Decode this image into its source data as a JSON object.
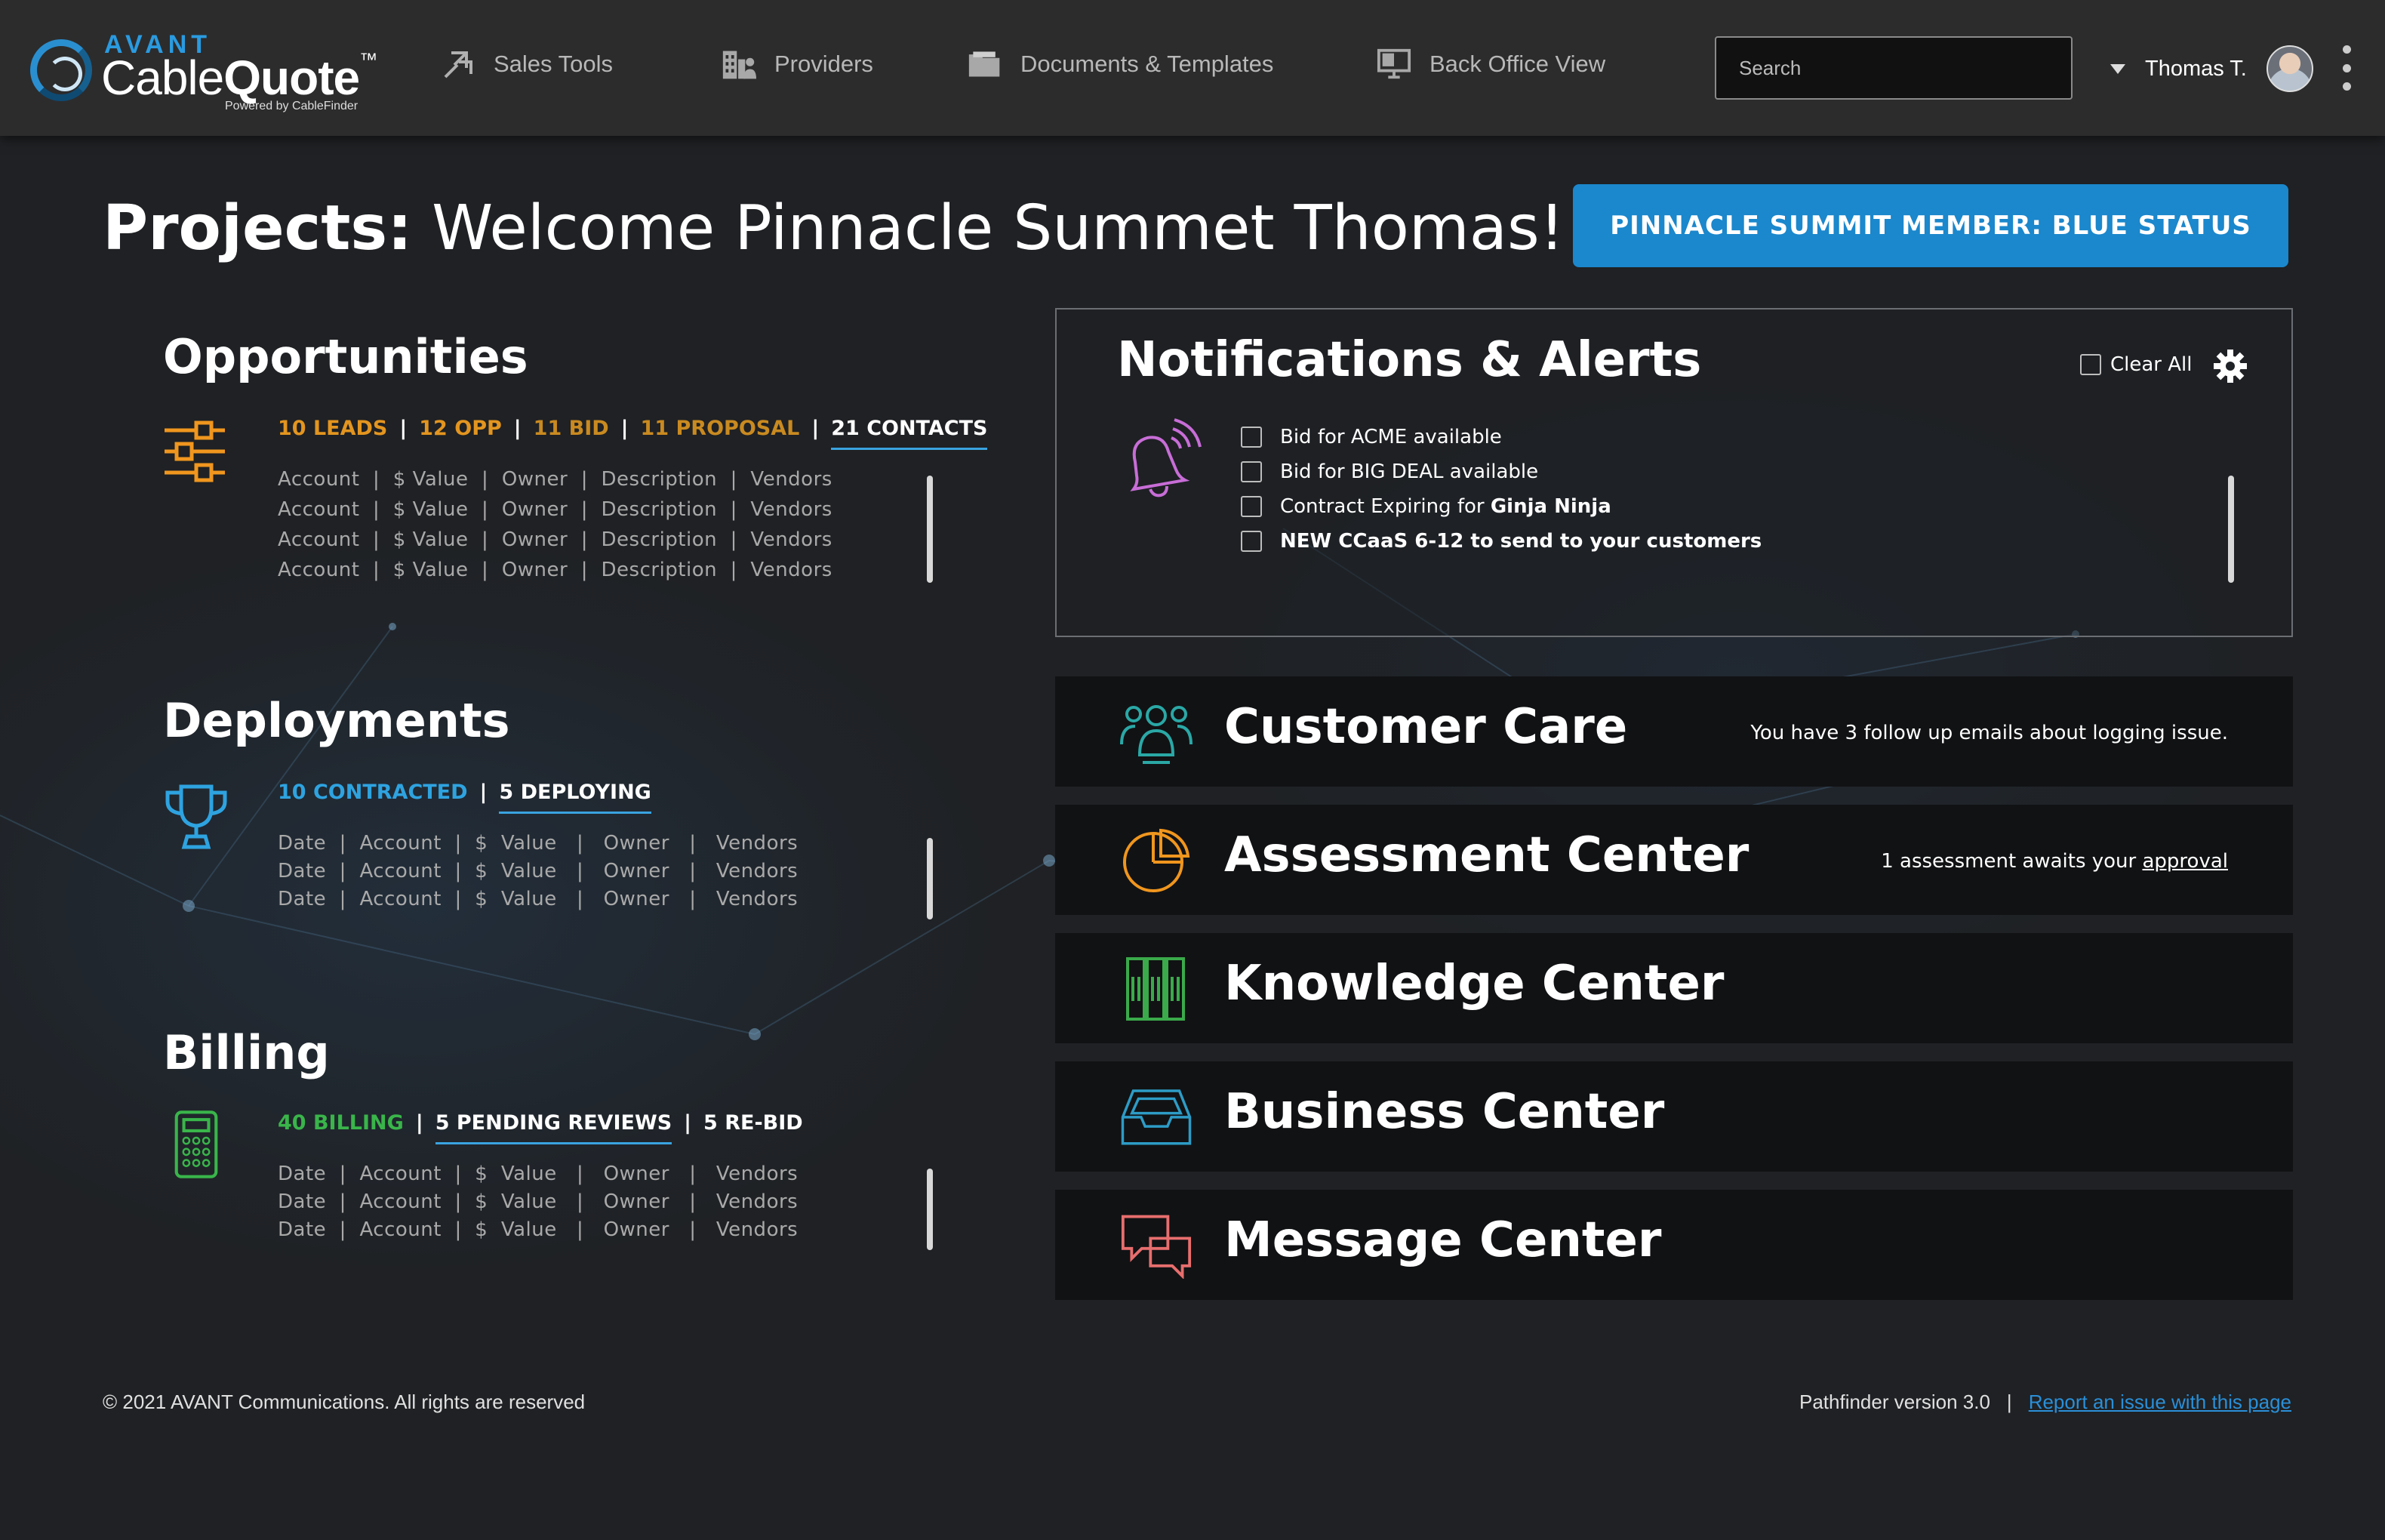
{
  "brand": {
    "avant": "AVANT",
    "name_light": "Cable",
    "name_bold": "Quote",
    "tm": "™",
    "powered": "Powered by CableFinder"
  },
  "nav": [
    {
      "label": "Sales Tools",
      "icon": "sales-tools-icon"
    },
    {
      "label": "Providers",
      "icon": "providers-icon"
    },
    {
      "label": "Documents & Templates",
      "icon": "folder-icon"
    },
    {
      "label": "Back Office View",
      "icon": "monitor-icon"
    }
  ],
  "search": {
    "placeholder": "Search",
    "value": ""
  },
  "user": {
    "name": "Thomas T."
  },
  "page": {
    "title_prefix": "Projects:",
    "title_rest": " Welcome Pinnacle Summet Thomas!"
  },
  "status_button": {
    "label": "PINNACLE SUMMIT MEMBER: BLUE STATUS"
  },
  "opportunities": {
    "title": "Opportunities",
    "stats": [
      {
        "label": "10 LEADS",
        "color": "#e3951f"
      },
      {
        "label": "12 OPP",
        "color": "#e3951f"
      },
      {
        "label": "11 BID",
        "color": "#c98a20"
      },
      {
        "label": "11 PROPOSAL",
        "color": "#c98a20"
      },
      {
        "label": "21 CONTACTS",
        "color": "#ffffff"
      }
    ],
    "rows": [
      "Account  |  $ Value  |  Owner  |  Description  |  Vendors",
      "Account  |  $ Value  |  Owner  |  Description  |  Vendors",
      "Account  |  $ Value  |  Owner  |  Description  |  Vendors",
      "Account  |  $ Value  |  Owner  |  Description  |  Vendors"
    ]
  },
  "deployments": {
    "title": "Deployments",
    "stats": [
      {
        "label": "10 CONTRACTED",
        "color": "#2ea3e0"
      },
      {
        "label": "5 DEPLOYING",
        "color": "#ffffff"
      }
    ],
    "rows": [
      "Date  |  Account  |  $  Value   |   Owner   |   Vendors",
      "Date  |  Account  |  $  Value   |   Owner   |   Vendors",
      "Date  |  Account  |  $  Value   |   Owner   |   Vendors"
    ]
  },
  "billing": {
    "title": "Billing",
    "stats": [
      {
        "label": "40 BILLING",
        "color": "#39b54a"
      },
      {
        "label": "5 PENDING REVIEWS",
        "color": "#ffffff"
      },
      {
        "label": "5 RE-BID",
        "color": "#ffffff"
      }
    ],
    "rows": [
      "Date  |  Account  |  $  Value   |   Owner   |   Vendors",
      "Date  |  Account  |  $  Value   |   Owner   |   Vendors",
      "Date  |  Account  |  $  Value   |   Owner   |   Vendors"
    ]
  },
  "notifications": {
    "title": "Notifications & Alerts",
    "clear_all": "Clear All",
    "items": [
      {
        "text": "Bid for ACME available",
        "bold": ""
      },
      {
        "text": "Bid for BIG DEAL available",
        "bold": ""
      },
      {
        "text": "Contract Expiring for ",
        "bold": "Ginja Ninja"
      },
      {
        "text": "NEW CCaaS 6-12 to send to your customers",
        "bold": ""
      }
    ]
  },
  "tiles": [
    {
      "title": "Customer Care",
      "note": "You have 3 follow up emails about logging issue.",
      "link": "",
      "icon": "team-icon",
      "color": "#2aa8a6"
    },
    {
      "title": "Assessment Center",
      "note": "1  assessment awaits your ",
      "link": "approval",
      "icon": "pie-chart-icon",
      "color": "#f0961e"
    },
    {
      "title": "Knowledge Center",
      "note": "",
      "link": "",
      "icon": "bookshelf-icon",
      "color": "#3aaa4a"
    },
    {
      "title": "Business Center",
      "note": "",
      "link": "",
      "icon": "inbox-tray-icon",
      "color": "#2d9cc6"
    },
    {
      "title": "Message Center",
      "note": "",
      "link": "",
      "icon": "chat-bubbles-icon",
      "color": "#e86e6e"
    }
  ],
  "footer": {
    "copyright": "© 2021 AVANT Communications. All rights are reserved",
    "version": "Pathfinder version 3.0",
    "divider": "|",
    "report_link": "Report an issue with this page"
  }
}
